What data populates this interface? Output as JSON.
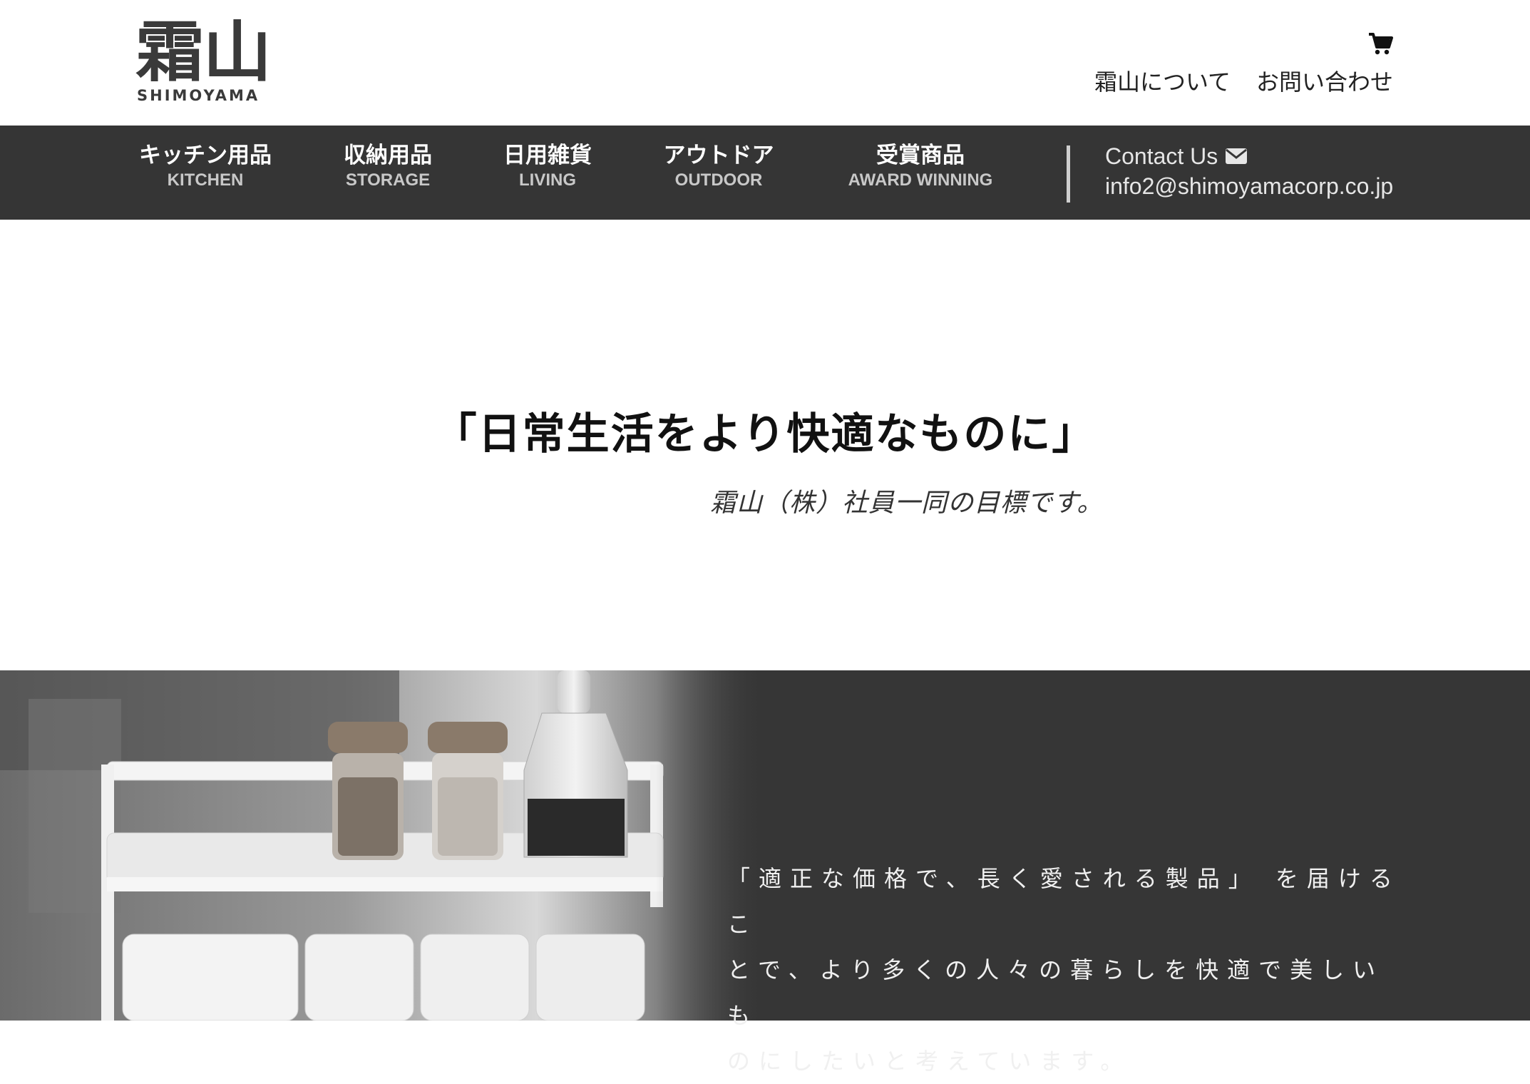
{
  "header": {
    "logo_kanji": "霜山",
    "logo_roman": "SHIMOYAMA",
    "links": [
      "霜山について",
      "お問い合わせ"
    ]
  },
  "nav": {
    "items": [
      {
        "jp": "キッチン用品",
        "en": "KITCHEN"
      },
      {
        "jp": "収納用品",
        "en": "STORAGE"
      },
      {
        "jp": "日用雑貨",
        "en": "LIVING"
      },
      {
        "jp": "アウトドア",
        "en": "OUTDOOR"
      },
      {
        "jp": "受賞商品",
        "en": "AWARD WINNING"
      }
    ],
    "contact_label": "Contact Us",
    "contact_email": "info2@shimoyamacorp.co.jp"
  },
  "hero": {
    "title": "「日常生活をより快適なものに」",
    "subtitle": "霜山（株）社員一同の目標です。"
  },
  "band": {
    "lines": [
      "「適正な価格で、長く愛される製品」 を届けるこ",
      "とで、より多くの人々の暮らしを快適で美しいも",
      "のにしたいと考えています。"
    ]
  },
  "colors": {
    "nav_bg": "#353535",
    "band_bg": "#363636",
    "nav_sub": "#c8c8c8"
  },
  "icons": [
    "cart-icon",
    "envelope-icon"
  ]
}
